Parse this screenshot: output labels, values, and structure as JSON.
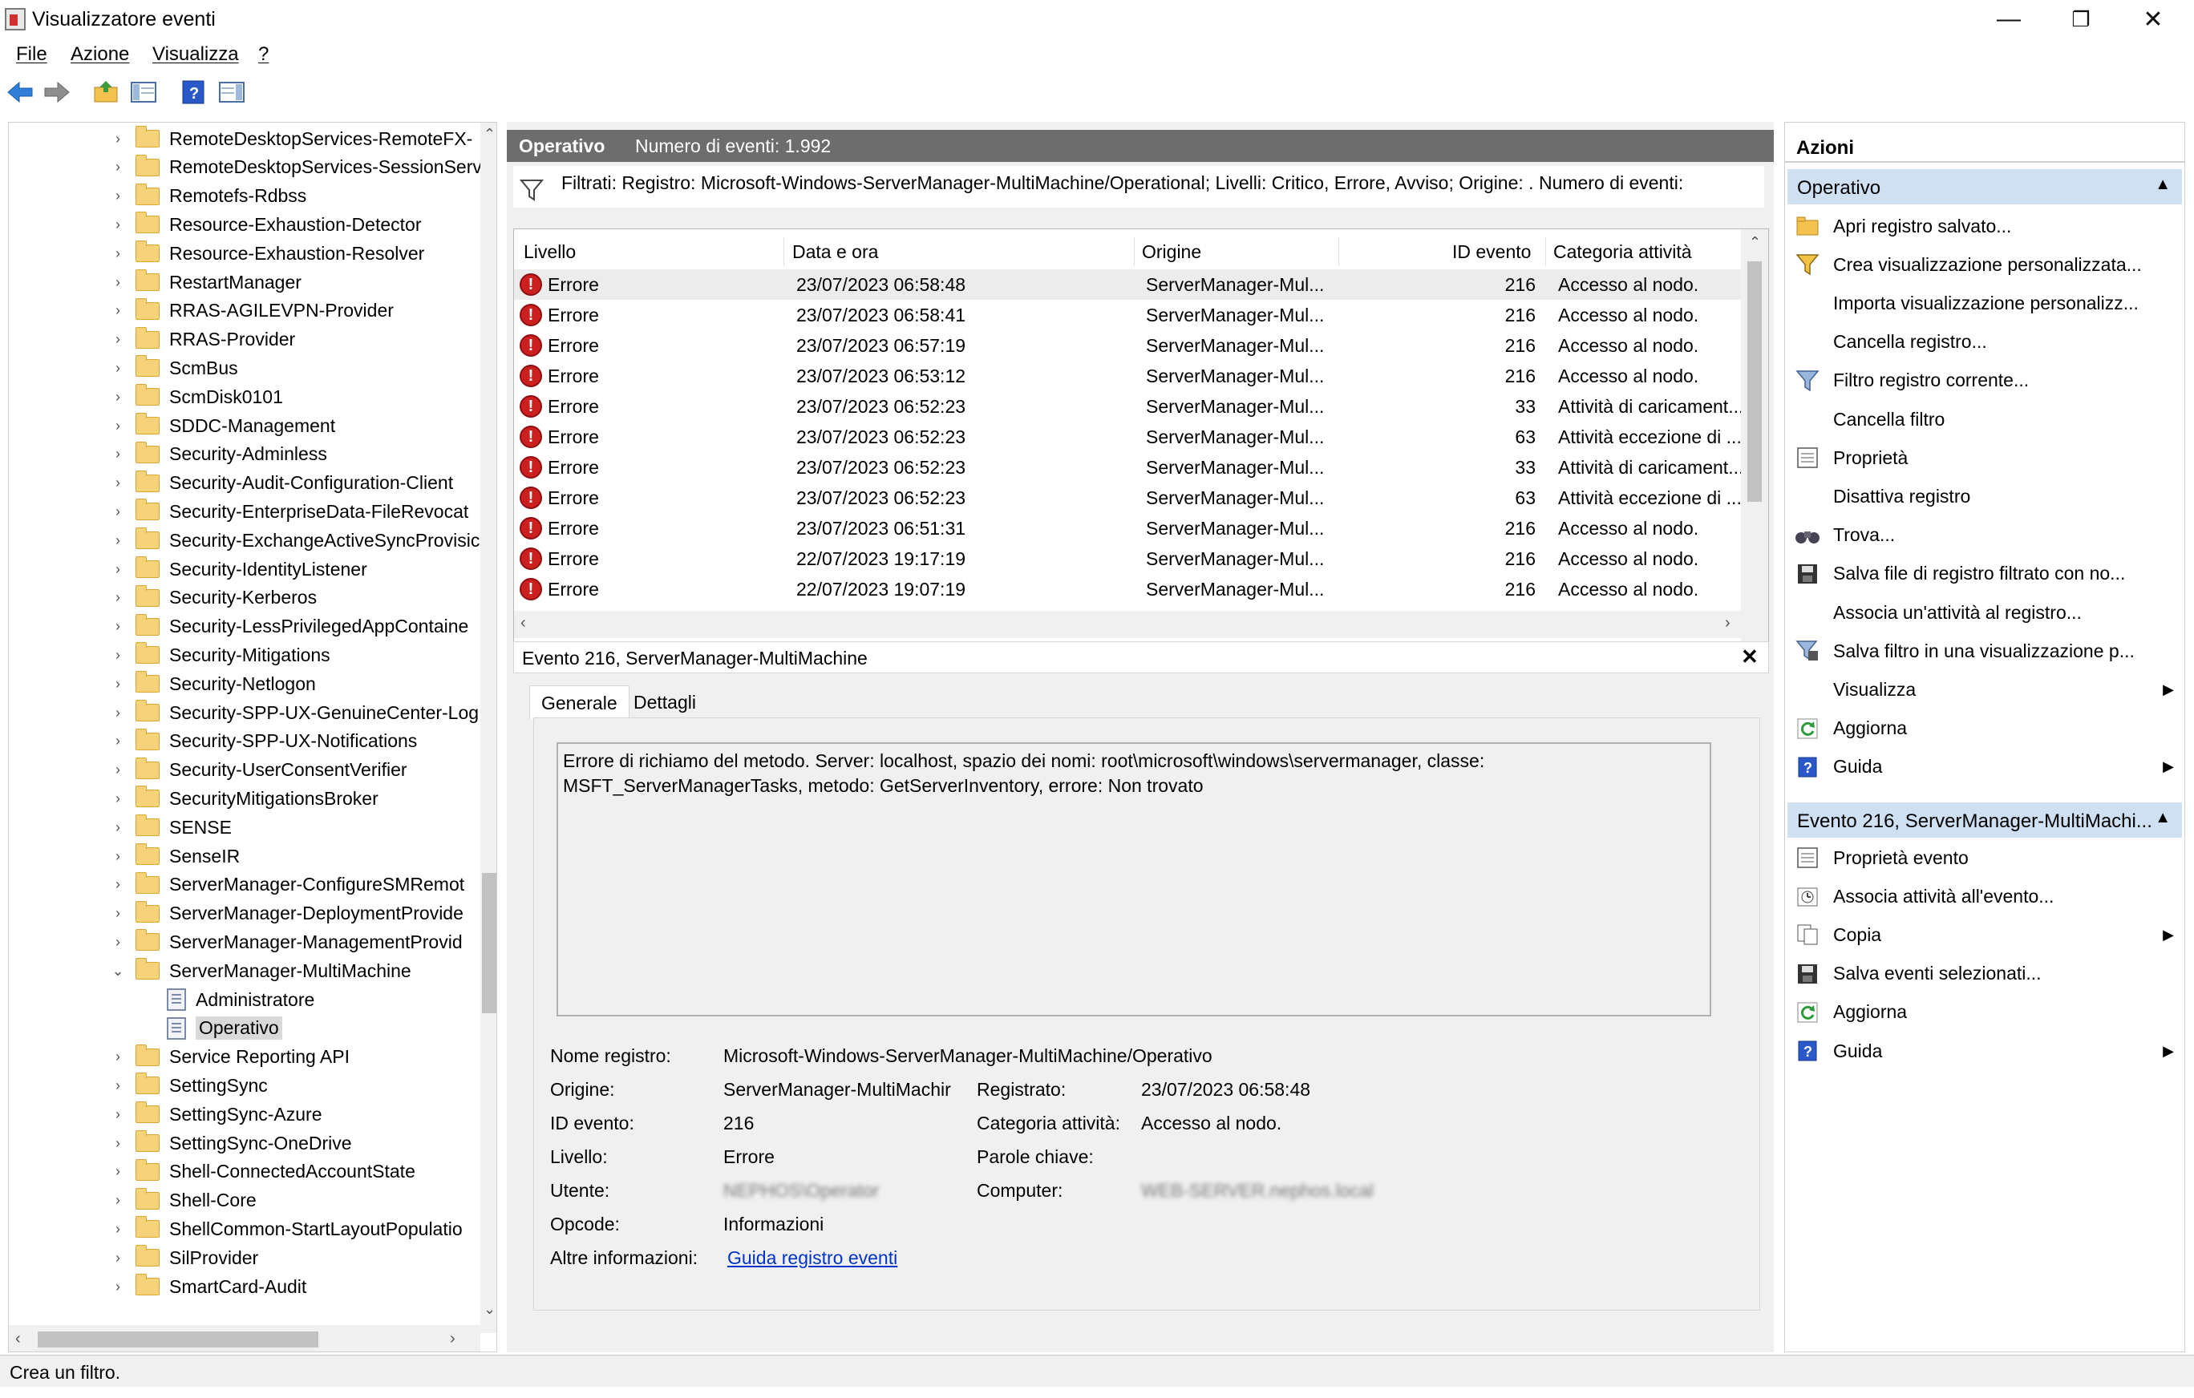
{
  "window": {
    "title": "Visualizzatore eventi",
    "minimize": "—",
    "restore": "❐",
    "close": "✕"
  },
  "menu": [
    "File",
    "Azione",
    "Visualizza",
    "?"
  ],
  "tree": {
    "items": [
      {
        "label": "RemoteDesktopServices-RemoteFX-",
        "expander": "›"
      },
      {
        "label": "RemoteDesktopServices-SessionServ",
        "expander": "›"
      },
      {
        "label": "Remotefs-Rdbss",
        "expander": "›"
      },
      {
        "label": "Resource-Exhaustion-Detector",
        "expander": "›"
      },
      {
        "label": "Resource-Exhaustion-Resolver",
        "expander": "›"
      },
      {
        "label": "RestartManager",
        "expander": "›"
      },
      {
        "label": "RRAS-AGILEVPN-Provider",
        "expander": "›"
      },
      {
        "label": "RRAS-Provider",
        "expander": "›"
      },
      {
        "label": "ScmBus",
        "expander": "›"
      },
      {
        "label": "ScmDisk0101",
        "expander": "›"
      },
      {
        "label": "SDDC-Management",
        "expander": "›"
      },
      {
        "label": "Security-Adminless",
        "expander": "›"
      },
      {
        "label": "Security-Audit-Configuration-Client",
        "expander": "›"
      },
      {
        "label": "Security-EnterpriseData-FileRevocat",
        "expander": "›"
      },
      {
        "label": "Security-ExchangeActiveSyncProvisic",
        "expander": "›"
      },
      {
        "label": "Security-IdentityListener",
        "expander": "›"
      },
      {
        "label": "Security-Kerberos",
        "expander": "›"
      },
      {
        "label": "Security-LessPrivilegedAppContaine",
        "expander": "›"
      },
      {
        "label": "Security-Mitigations",
        "expander": "›"
      },
      {
        "label": "Security-Netlogon",
        "expander": "›"
      },
      {
        "label": "Security-SPP-UX-GenuineCenter-Log",
        "expander": "›"
      },
      {
        "label": "Security-SPP-UX-Notifications",
        "expander": "›"
      },
      {
        "label": "Security-UserConsentVerifier",
        "expander": "›"
      },
      {
        "label": "SecurityMitigationsBroker",
        "expander": "›"
      },
      {
        "label": "SENSE",
        "expander": "›"
      },
      {
        "label": "SenseIR",
        "expander": "›"
      },
      {
        "label": "ServerManager-ConfigureSMRemot",
        "expander": "›"
      },
      {
        "label": "ServerManager-DeploymentProvide",
        "expander": "›"
      },
      {
        "label": "ServerManager-ManagementProvid",
        "expander": "›"
      },
      {
        "label": "ServerManager-MultiMachine",
        "expander": "⌄"
      },
      {
        "label": "Administratore",
        "child": true
      },
      {
        "label": "Operativo",
        "child": true,
        "selected": true
      },
      {
        "label": "Service Reporting API",
        "expander": "›"
      },
      {
        "label": "SettingSync",
        "expander": "›"
      },
      {
        "label": "SettingSync-Azure",
        "expander": "›"
      },
      {
        "label": "SettingSync-OneDrive",
        "expander": "›"
      },
      {
        "label": "Shell-ConnectedAccountState",
        "expander": "›"
      },
      {
        "label": "Shell-Core",
        "expander": "›"
      },
      {
        "label": "ShellCommon-StartLayoutPopulatio",
        "expander": "›"
      },
      {
        "label": "SilProvider",
        "expander": "›"
      },
      {
        "label": "SmartCard-Audit",
        "expander": "›"
      }
    ]
  },
  "center": {
    "header_title": "Operativo",
    "header_count": "Numero di eventi: 1.992",
    "filter_text": "Filtrati: Registro: Microsoft-Windows-ServerManager-MultiMachine/Operational; Livelli: Critico, Errore, Avviso; Origine: . Numero di eventi:",
    "columns": [
      "Livello",
      "Data e ora",
      "Origine",
      "ID evento",
      "Categoria attività"
    ],
    "rows": [
      {
        "level": "Errore",
        "date": "23/07/2023 06:58:48",
        "source": "ServerManager-Mul...",
        "id": "216",
        "category": "Accesso al nodo."
      },
      {
        "level": "Errore",
        "date": "23/07/2023 06:58:41",
        "source": "ServerManager-Mul...",
        "id": "216",
        "category": "Accesso al nodo."
      },
      {
        "level": "Errore",
        "date": "23/07/2023 06:57:19",
        "source": "ServerManager-Mul...",
        "id": "216",
        "category": "Accesso al nodo."
      },
      {
        "level": "Errore",
        "date": "23/07/2023 06:53:12",
        "source": "ServerManager-Mul...",
        "id": "216",
        "category": "Accesso al nodo."
      },
      {
        "level": "Errore",
        "date": "23/07/2023 06:52:23",
        "source": "ServerManager-Mul...",
        "id": "33",
        "category": "Attività di caricament..."
      },
      {
        "level": "Errore",
        "date": "23/07/2023 06:52:23",
        "source": "ServerManager-Mul...",
        "id": "63",
        "category": "Attività eccezione di ..."
      },
      {
        "level": "Errore",
        "date": "23/07/2023 06:52:23",
        "source": "ServerManager-Mul...",
        "id": "33",
        "category": "Attività di caricament..."
      },
      {
        "level": "Errore",
        "date": "23/07/2023 06:52:23",
        "source": "ServerManager-Mul...",
        "id": "63",
        "category": "Attività eccezione di ..."
      },
      {
        "level": "Errore",
        "date": "23/07/2023 06:51:31",
        "source": "ServerManager-Mul...",
        "id": "216",
        "category": "Accesso al nodo."
      },
      {
        "level": "Errore",
        "date": "22/07/2023 19:17:19",
        "source": "ServerManager-Mul...",
        "id": "216",
        "category": "Accesso al nodo."
      },
      {
        "level": "Errore",
        "date": "22/07/2023 19:07:19",
        "source": "ServerManager-Mul...",
        "id": "216",
        "category": "Accesso al nodo."
      }
    ]
  },
  "detail": {
    "title": "Evento 216, ServerManager-MultiMachine",
    "tabs": [
      "Generale",
      "Dettagli"
    ],
    "description": "Errore di richiamo del metodo. Server: localhost, spazio dei nomi: root\\microsoft\\windows\\servermanager, classe: MSFT_ServerManagerTasks, metodo: GetServerInventory, errore: Non trovato",
    "fields": {
      "log_name_label": "Nome registro:",
      "log_name": "Microsoft-Windows-ServerManager-MultiMachine/Operativo",
      "source_label": "Origine:",
      "source": "ServerManager-MultiMachir",
      "logged_label": "Registrato:",
      "logged": "23/07/2023 06:58:48",
      "event_id_label": "ID evento:",
      "event_id": "216",
      "task_label": "Categoria attività:",
      "task": "Accesso al nodo.",
      "level_label": "Livello:",
      "level": "Errore",
      "keywords_label": "Parole chiave:",
      "user_label": "Utente:",
      "user": "NEPHOS\\Operator",
      "computer_label": "Computer:",
      "computer": "WEB-SERVER.nephos.local",
      "opcode_label": "Opcode:",
      "opcode": "Informazioni",
      "more_info_label": "Altre informazioni:",
      "more_info_link": "Guida registro eventi"
    }
  },
  "actions": {
    "title": "Azioni",
    "section1": "Operativo",
    "items1": [
      {
        "label": "Apri registro salvato...",
        "icon": "folder-open-icon"
      },
      {
        "label": "Crea visualizzazione personalizzata...",
        "icon": "filter-create-icon"
      },
      {
        "label": "Importa visualizzazione personalizz...",
        "icon": ""
      },
      {
        "label": "Cancella registro...",
        "icon": ""
      },
      {
        "label": "Filtro registro corrente...",
        "icon": "filter-icon"
      },
      {
        "label": "Cancella filtro",
        "icon": ""
      },
      {
        "label": "Proprietà",
        "icon": "properties-icon"
      },
      {
        "label": "Disattiva registro",
        "icon": ""
      },
      {
        "label": "Trova...",
        "icon": "binoculars-icon"
      },
      {
        "label": "Salva file di registro filtrato con no...",
        "icon": "save-icon"
      },
      {
        "label": "Associa un'attività al registro...",
        "icon": ""
      },
      {
        "label": "Salva filtro in una visualizzazione p...",
        "icon": "filter-save-icon"
      },
      {
        "label": "Visualizza",
        "icon": "",
        "submenu": true
      },
      {
        "label": "Aggiorna",
        "icon": "refresh-icon"
      },
      {
        "label": "Guida",
        "icon": "help-icon",
        "submenu": true
      }
    ],
    "section2": "Evento 216, ServerManager-MultiMachi...",
    "items2": [
      {
        "label": "Proprietà evento",
        "icon": "properties-icon"
      },
      {
        "label": "Associa attività all'evento...",
        "icon": "task-icon"
      },
      {
        "label": "Copia",
        "icon": "copy-icon",
        "submenu": true
      },
      {
        "label": "Salva eventi selezionati...",
        "icon": "save-icon"
      },
      {
        "label": "Aggiorna",
        "icon": "refresh-icon"
      },
      {
        "label": "Guida",
        "icon": "help-icon",
        "submenu": true
      }
    ]
  },
  "status": "Crea un filtro.",
  "colors": {
    "accent": "#cfe0f3",
    "header": "#6d6d6d",
    "error": "#cc1f1f",
    "link": "#0033cc"
  }
}
